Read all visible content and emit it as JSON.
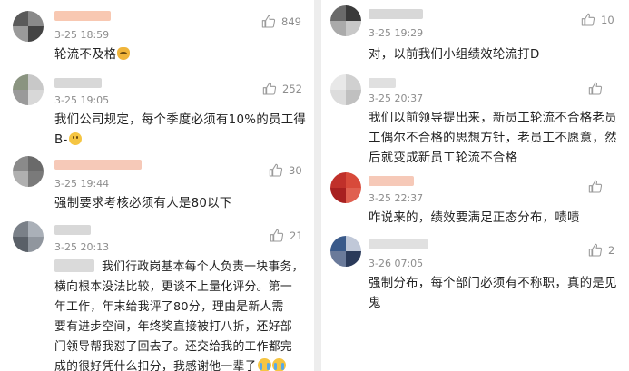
{
  "left": {
    "comments": [
      {
        "time": "3-25 18:59",
        "likes": "849",
        "lines": [
          "轮流不及格"
        ],
        "emoji_end": "cat-smirk-emoji"
      },
      {
        "time": "3-25 19:05",
        "likes": "252",
        "lines": [
          "我们公司规定，每个季度必须有10%的员工得",
          "B-"
        ],
        "emoji_end": "smile-emoji"
      },
      {
        "time": "3-25 19:44",
        "likes": "30",
        "lines": [
          "强制要求考核必须有人是80以下"
        ]
      },
      {
        "time": "3-25 20:13",
        "likes": "21",
        "lines": [
          "我们行政岗基本每个人负责一块事务，",
          "横向根本没法比较，更谈不上量化评分。第一",
          "年工作，年末给我评了80分，理由是新人需",
          "要有进步空间，年终奖直接被打八折，还好部",
          "门领导帮我怼了回去了。还交给我的工作都完",
          "成的很好凭什么扣分，我感谢他一辈子"
        ],
        "emoji_end": "crying-emoji"
      }
    ]
  },
  "right": {
    "comments": [
      {
        "time": "3-25 19:29",
        "likes": "10",
        "lines": [
          "对，以前我们小组绩效轮流打D"
        ]
      },
      {
        "time": "3-25 20:37",
        "likes": "",
        "lines": [
          "我们以前领导提出来，新员工轮流不合格老员",
          "工偶尔不合格的思想方针，老员工不愿意，然",
          "后就变成新员工轮流不合格"
        ]
      },
      {
        "time": "3-25 22:37",
        "likes": "",
        "lines": [
          "咋说来的，绩效要满足正态分布，啧啧"
        ]
      },
      {
        "time": "3-26 07:05",
        "likes": "2",
        "lines": [
          "强制分布，每个部门必须有不称职，真的是见",
          "鬼"
        ]
      }
    ]
  },
  "colors": {
    "divider": "#ededed",
    "meta_text": "#8d8d8d",
    "body_text": "#222222",
    "name_blur": "#f6c9b8"
  },
  "icons": {
    "like": "thumbs-up-icon"
  }
}
